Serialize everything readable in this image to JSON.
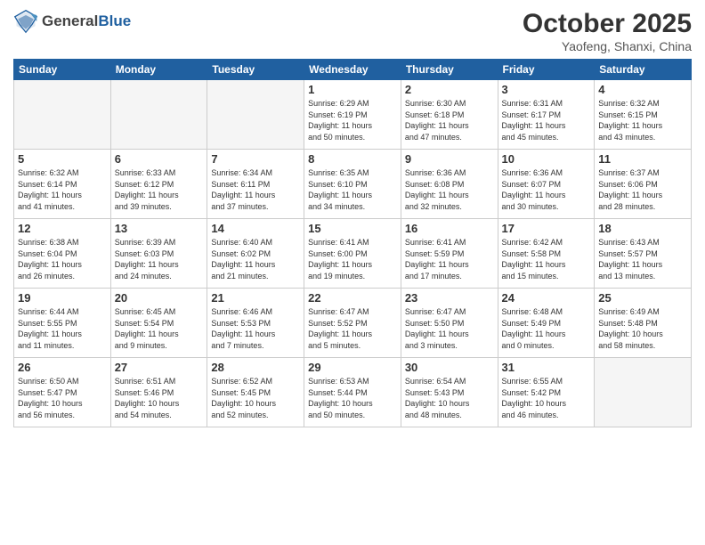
{
  "header": {
    "logo_general": "General",
    "logo_blue": "Blue",
    "month_title": "October 2025",
    "location": "Yaofeng, Shanxi, China"
  },
  "weekdays": [
    "Sunday",
    "Monday",
    "Tuesday",
    "Wednesday",
    "Thursday",
    "Friday",
    "Saturday"
  ],
  "weeks": [
    [
      {
        "day": "",
        "info": "",
        "empty": true
      },
      {
        "day": "",
        "info": "",
        "empty": true
      },
      {
        "day": "",
        "info": "",
        "empty": true
      },
      {
        "day": "1",
        "info": "Sunrise: 6:29 AM\nSunset: 6:19 PM\nDaylight: 11 hours\nand 50 minutes."
      },
      {
        "day": "2",
        "info": "Sunrise: 6:30 AM\nSunset: 6:18 PM\nDaylight: 11 hours\nand 47 minutes."
      },
      {
        "day": "3",
        "info": "Sunrise: 6:31 AM\nSunset: 6:17 PM\nDaylight: 11 hours\nand 45 minutes."
      },
      {
        "day": "4",
        "info": "Sunrise: 6:32 AM\nSunset: 6:15 PM\nDaylight: 11 hours\nand 43 minutes."
      }
    ],
    [
      {
        "day": "5",
        "info": "Sunrise: 6:32 AM\nSunset: 6:14 PM\nDaylight: 11 hours\nand 41 minutes."
      },
      {
        "day": "6",
        "info": "Sunrise: 6:33 AM\nSunset: 6:12 PM\nDaylight: 11 hours\nand 39 minutes."
      },
      {
        "day": "7",
        "info": "Sunrise: 6:34 AM\nSunset: 6:11 PM\nDaylight: 11 hours\nand 37 minutes."
      },
      {
        "day": "8",
        "info": "Sunrise: 6:35 AM\nSunset: 6:10 PM\nDaylight: 11 hours\nand 34 minutes."
      },
      {
        "day": "9",
        "info": "Sunrise: 6:36 AM\nSunset: 6:08 PM\nDaylight: 11 hours\nand 32 minutes."
      },
      {
        "day": "10",
        "info": "Sunrise: 6:36 AM\nSunset: 6:07 PM\nDaylight: 11 hours\nand 30 minutes."
      },
      {
        "day": "11",
        "info": "Sunrise: 6:37 AM\nSunset: 6:06 PM\nDaylight: 11 hours\nand 28 minutes."
      }
    ],
    [
      {
        "day": "12",
        "info": "Sunrise: 6:38 AM\nSunset: 6:04 PM\nDaylight: 11 hours\nand 26 minutes."
      },
      {
        "day": "13",
        "info": "Sunrise: 6:39 AM\nSunset: 6:03 PM\nDaylight: 11 hours\nand 24 minutes."
      },
      {
        "day": "14",
        "info": "Sunrise: 6:40 AM\nSunset: 6:02 PM\nDaylight: 11 hours\nand 21 minutes."
      },
      {
        "day": "15",
        "info": "Sunrise: 6:41 AM\nSunset: 6:00 PM\nDaylight: 11 hours\nand 19 minutes."
      },
      {
        "day": "16",
        "info": "Sunrise: 6:41 AM\nSunset: 5:59 PM\nDaylight: 11 hours\nand 17 minutes."
      },
      {
        "day": "17",
        "info": "Sunrise: 6:42 AM\nSunset: 5:58 PM\nDaylight: 11 hours\nand 15 minutes."
      },
      {
        "day": "18",
        "info": "Sunrise: 6:43 AM\nSunset: 5:57 PM\nDaylight: 11 hours\nand 13 minutes."
      }
    ],
    [
      {
        "day": "19",
        "info": "Sunrise: 6:44 AM\nSunset: 5:55 PM\nDaylight: 11 hours\nand 11 minutes."
      },
      {
        "day": "20",
        "info": "Sunrise: 6:45 AM\nSunset: 5:54 PM\nDaylight: 11 hours\nand 9 minutes."
      },
      {
        "day": "21",
        "info": "Sunrise: 6:46 AM\nSunset: 5:53 PM\nDaylight: 11 hours\nand 7 minutes."
      },
      {
        "day": "22",
        "info": "Sunrise: 6:47 AM\nSunset: 5:52 PM\nDaylight: 11 hours\nand 5 minutes."
      },
      {
        "day": "23",
        "info": "Sunrise: 6:47 AM\nSunset: 5:50 PM\nDaylight: 11 hours\nand 3 minutes."
      },
      {
        "day": "24",
        "info": "Sunrise: 6:48 AM\nSunset: 5:49 PM\nDaylight: 11 hours\nand 0 minutes."
      },
      {
        "day": "25",
        "info": "Sunrise: 6:49 AM\nSunset: 5:48 PM\nDaylight: 10 hours\nand 58 minutes."
      }
    ],
    [
      {
        "day": "26",
        "info": "Sunrise: 6:50 AM\nSunset: 5:47 PM\nDaylight: 10 hours\nand 56 minutes."
      },
      {
        "day": "27",
        "info": "Sunrise: 6:51 AM\nSunset: 5:46 PM\nDaylight: 10 hours\nand 54 minutes."
      },
      {
        "day": "28",
        "info": "Sunrise: 6:52 AM\nSunset: 5:45 PM\nDaylight: 10 hours\nand 52 minutes."
      },
      {
        "day": "29",
        "info": "Sunrise: 6:53 AM\nSunset: 5:44 PM\nDaylight: 10 hours\nand 50 minutes."
      },
      {
        "day": "30",
        "info": "Sunrise: 6:54 AM\nSunset: 5:43 PM\nDaylight: 10 hours\nand 48 minutes."
      },
      {
        "day": "31",
        "info": "Sunrise: 6:55 AM\nSunset: 5:42 PM\nDaylight: 10 hours\nand 46 minutes."
      },
      {
        "day": "",
        "info": "",
        "empty": true
      }
    ]
  ]
}
